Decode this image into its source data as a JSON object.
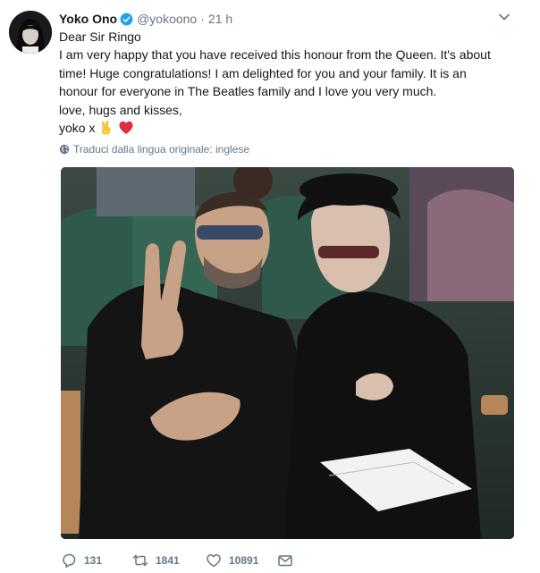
{
  "tweet": {
    "author": {
      "name": "Yoko Ono",
      "handle": "@yokoono",
      "time": "21 h",
      "avatar_icon": "profile-photo"
    },
    "text_lines": [
      "Dear Sir Ringo",
      "I am very happy that you have received this honour from the Queen. It's about",
      "time! Huge congratulations! I am delighted for you and your family. It is an",
      "honour for everyone in The Beatles family and I love you very much.",
      "love, hugs and kisses,"
    ],
    "signature": "yoko x",
    "signature_emojis": [
      "victory-hand-emoji",
      "red-heart-emoji"
    ],
    "translate_text": "Traduci dalla lingua originale: inglese",
    "photo_icon": "photo-two-people-in-theater-seats",
    "actions": {
      "replies": "131",
      "retweets": "1841",
      "likes": "10891"
    },
    "colors": {
      "verified": "#1da1f2",
      "text": "#14171a",
      "muted": "#657786",
      "heart": "#e0245e"
    }
  }
}
